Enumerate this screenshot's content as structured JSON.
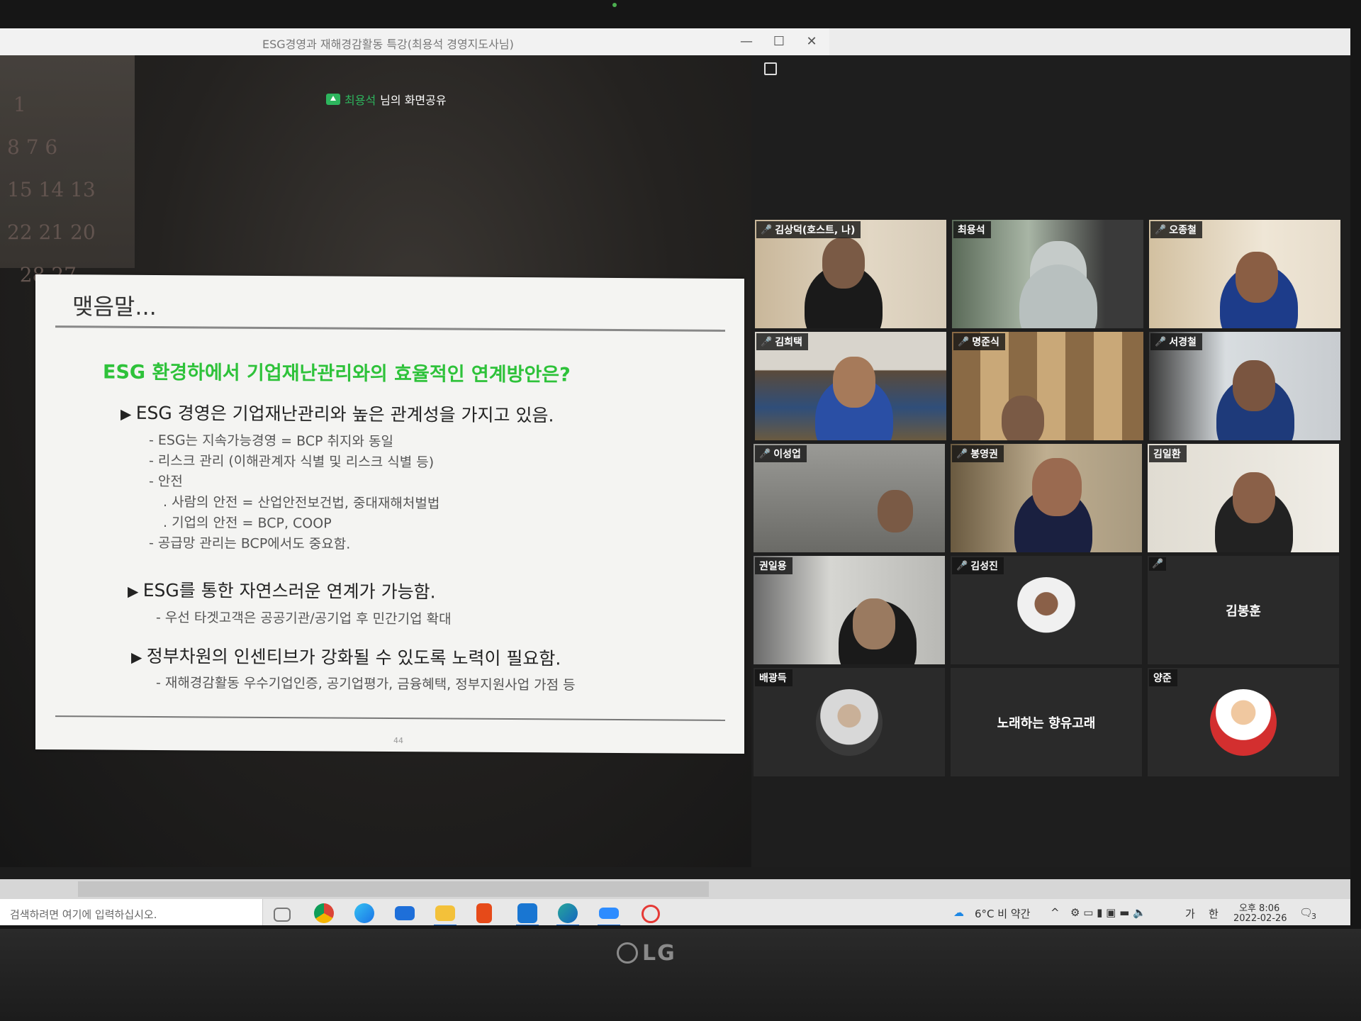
{
  "window": {
    "title": "ESG경영과 재해경감활동 특강(최용석 경영지도사님)",
    "minimize": "—",
    "maximize": "☐",
    "close": "✕"
  },
  "share_banner": {
    "presenter": "최용석",
    "suffix": " 님의 화면공유"
  },
  "slide": {
    "heading": "맺음말...",
    "question": "ESG 환경하에서 기업재난관리와의 효율적인 연계방안은?",
    "bullets": [
      {
        "text": "ESG 경영은 기업재난관리와 높은 관계성을 가지고 있음.",
        "subs": [
          "- ESG는 지속가능경영 = BCP 취지와 동일",
          "- 리스크 관리 (이해관계자 식별 및 리스크 식별 등)",
          "- 안전",
          ". 사람의 안전 = 산업안전보건법, 중대재해처벌법",
          ". 기업의 안전 = BCP, COOP",
          "- 공급망 관리는 BCP에서도 중요함."
        ]
      },
      {
        "text": "ESG를 통한 자연스러운 연계가 가능함.",
        "subs": [
          "- 우선 타겟고객은 공공기관/공기업 후 민간기업 확대"
        ]
      },
      {
        "text": "정부차원의 인센티브가 강화될 수 있도록 노력이 필요함.",
        "subs": [
          "- 재해경감활동 우수기업인증, 공기업평가, 금융혜택, 정부지원사업 가점 등"
        ]
      }
    ],
    "page_number": "44"
  },
  "participants": [
    {
      "name": "김상덕(호스트, 나)",
      "muted": true,
      "video": true
    },
    {
      "name": "최용석",
      "muted": false,
      "video": true,
      "active": true
    },
    {
      "name": "오종철",
      "muted": true,
      "video": true
    },
    {
      "name": "김희택",
      "muted": true,
      "video": true
    },
    {
      "name": "명준식",
      "muted": true,
      "video": true
    },
    {
      "name": "서경철",
      "muted": true,
      "video": true
    },
    {
      "name": "이성업",
      "muted": true,
      "video": true
    },
    {
      "name": "봉영권",
      "muted": true,
      "video": true
    },
    {
      "name": "김일환",
      "muted": false,
      "video": true
    },
    {
      "name": "권일용",
      "muted": false,
      "video": true
    },
    {
      "name": "김성진",
      "muted": true,
      "video": false
    },
    {
      "name": "",
      "display_name": "김봉훈",
      "muted": true,
      "video": false
    },
    {
      "name": "배광득",
      "muted": false,
      "video": false
    },
    {
      "name": "",
      "display_name": "노래하는 향유고래",
      "muted": false,
      "video": false
    },
    {
      "name": "양준",
      "muted": false,
      "video": false
    }
  ],
  "taskbar": {
    "search_placeholder": "검색하려면 여기에 입력하십시오.",
    "apps": [
      "task-view-icon",
      "chrome-icon",
      "edge-icon",
      "mail-icon",
      "file-explorer-icon",
      "office-icon",
      "app-icon",
      "app-icon-2",
      "zoom-icon",
      "snip-icon"
    ],
    "weather": "6°C  비 약간",
    "ime": "가",
    "ime2": "한",
    "time": "오후 8:06",
    "date": "2022-02-26",
    "notification_count": "3"
  },
  "colors": {
    "slide_question": "#2ec23a",
    "active_speaker": "#2fd27a",
    "mute": "#e53935",
    "share_icon": "#2db55d"
  },
  "monitor_brand": "LG"
}
